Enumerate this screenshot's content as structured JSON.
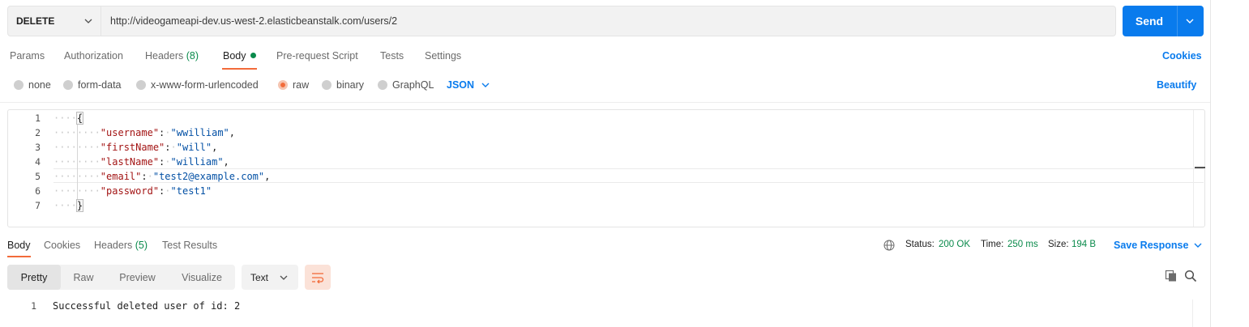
{
  "request": {
    "method": "DELETE",
    "url": "http://videogameapi-dev.us-west-2.elasticbeanstalk.com/users/2",
    "send_label": "Send"
  },
  "request_tabs": {
    "params": "Params",
    "authorization": "Authorization",
    "headers": "Headers",
    "headers_count": "(8)",
    "body": "Body",
    "prerequest": "Pre-request Script",
    "tests": "Tests",
    "settings": "Settings",
    "cookies": "Cookies"
  },
  "body_types": {
    "none": "none",
    "form_data": "form-data",
    "urlencoded": "x-www-form-urlencoded",
    "raw": "raw",
    "binary": "binary",
    "graphql": "GraphQL",
    "selected": "raw",
    "format": "JSON",
    "beautify": "Beautify"
  },
  "editor": {
    "line_numbers": [
      "1",
      "2",
      "3",
      "4",
      "5",
      "6",
      "7"
    ],
    "lines": [
      {
        "key": "",
        "value": ""
      },
      {
        "key": "\"username\"",
        "value": "\"wwilliam\""
      },
      {
        "key": "\"firstName\"",
        "value": "\"will\""
      },
      {
        "key": "\"lastName\"",
        "value": "\"william\""
      },
      {
        "key": "\"email\"",
        "value": "\"test2@example.com\""
      },
      {
        "key": "\"password\"",
        "value": "\"test1\""
      },
      {
        "key": "",
        "value": ""
      }
    ],
    "open_brace": "{",
    "close_brace": "}",
    "colon": ":",
    "comma": ","
  },
  "response_tabs": {
    "body": "Body",
    "cookies": "Cookies",
    "headers": "Headers",
    "headers_count": "(5)",
    "test_results": "Test Results"
  },
  "response_status": {
    "status_label": "Status:",
    "status_value": "200 OK",
    "time_label": "Time:",
    "time_value": "250 ms",
    "size_label": "Size:",
    "size_value": "194 B",
    "save_response": "Save Response"
  },
  "view_modes": {
    "pretty": "Pretty",
    "raw": "Raw",
    "preview": "Preview",
    "visualize": "Visualize",
    "selected": "Pretty",
    "type": "Text"
  },
  "response_body": {
    "line_number": "1",
    "text": "Successful deleted user of id: 2"
  },
  "colors": {
    "accent": "#097bed",
    "active_tab": "#f26b3a",
    "success": "#0a8a4b"
  },
  "icons": [
    "chevron-down-icon",
    "globe-icon",
    "wrap-lines-icon",
    "copy-icon",
    "search-icon"
  ]
}
